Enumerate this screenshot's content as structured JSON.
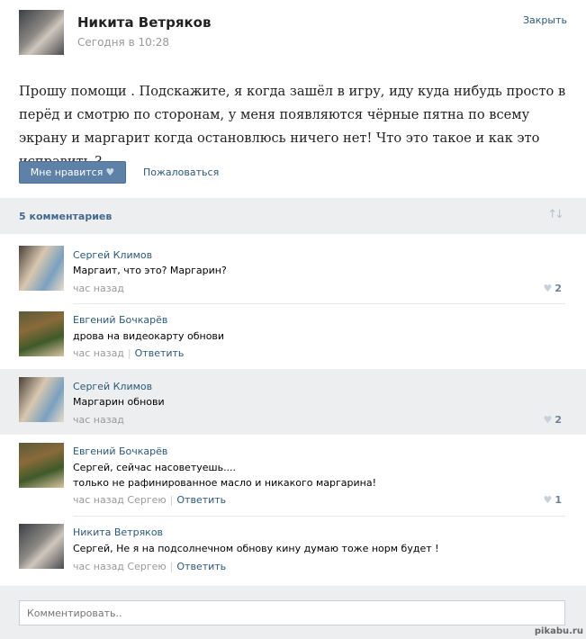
{
  "post": {
    "author": "Никита Ветряков",
    "time": "Сегодня в 10:28",
    "close_label": "Закрыть",
    "text": "Прошу помощи . Подскажите, я когда зашёл в игру, иду куда нибудь просто в перёд и смотрю по сторонам, у меня появляются чёрные пятна по всему экрану и маргарит когда остановлюсь ничего нет! Что это такое и как это исправить ?",
    "like_label": "Мне нравится",
    "report_label": "Пожаловаться"
  },
  "comments_header": {
    "count_label": "5 комментариев",
    "sort_icon": "sort-arrows-icon"
  },
  "comments": [
    {
      "author": "Сергей Климов",
      "text": "Маргаит, что это? Маргарин?",
      "time": "час назад",
      "reply_to": "",
      "reply_label": "",
      "likes": "2"
    },
    {
      "author": "Евгений Бочкарёв",
      "text": "дрова на видеокарту обнови",
      "time": "час назад",
      "reply_to": "",
      "reply_label": "Ответить",
      "likes": ""
    },
    {
      "author": "Сергей Климов",
      "text": "Маргарин обнови",
      "time": "час назад",
      "reply_to": "",
      "reply_label": "",
      "likes": "2"
    },
    {
      "author": "Евгений Бочкарёв",
      "text": "Сергей, сейчас насоветуешь....",
      "text2": "только не рафинированное масло и никакого маргарина!",
      "time": "час назад",
      "reply_to": "Сергею",
      "reply_label": "Ответить",
      "likes": "1"
    },
    {
      "author": "Никита Ветряков",
      "text": "Сергей, Не я на подсолнечном обнову кину думаю тоже норм будет !",
      "time": "час назад",
      "reply_to": "Сергею",
      "reply_label": "Ответить",
      "likes": ""
    }
  ],
  "footer": {
    "comment_placeholder": "Комментировать.."
  },
  "watermark": "pikabu.ru",
  "colors": {
    "link": "#2b587a",
    "like_button": "#5e81a8",
    "bar_bg": "#edeef0"
  }
}
